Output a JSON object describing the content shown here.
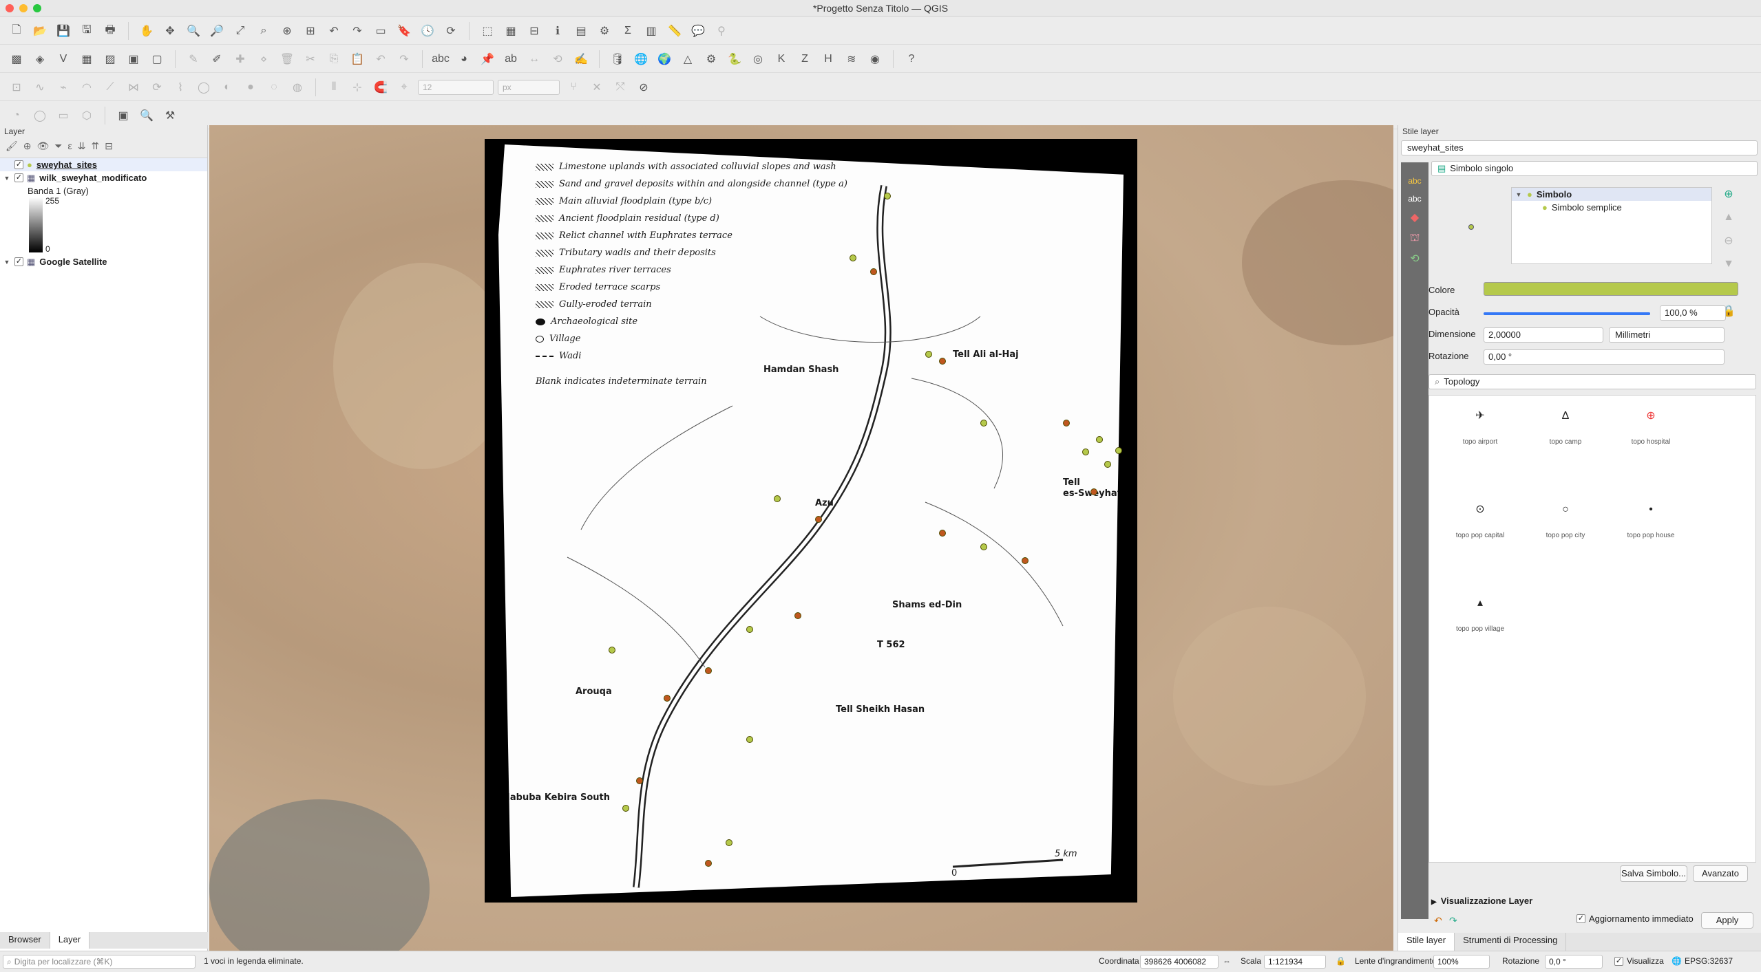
{
  "window": {
    "title": "*Progetto Senza Titolo — QGIS"
  },
  "toolbars": {
    "scale_value": "12",
    "unit_value": "px"
  },
  "layers_panel": {
    "title": "Layer",
    "layers": [
      {
        "name": "sweyhat_sites",
        "checked": "✓"
      },
      {
        "name": "wilk_sweyhat_modificato",
        "checked": "✓"
      },
      {
        "name": "Google Satellite",
        "checked": "✓"
      }
    ],
    "band_label": "Banda 1 (Gray)",
    "band_max": "255",
    "band_min": "0",
    "tabs": [
      "Browser",
      "Layer"
    ]
  },
  "map": {
    "legend": [
      "Limestone uplands with associated colluvial slopes and wash",
      "Sand and gravel deposits within and alongside channel (type a)",
      "Main alluvial floodplain (type b/c)",
      "Ancient floodplain residual (type d)",
      "Relict channel with Euphrates terrace",
      "Tributary wadis and their deposits",
      "Euphrates river terraces",
      "Eroded terrace scarps",
      "Gully-eroded terrain",
      "Archaeological site",
      "Village",
      "Wadi"
    ],
    "legend_note": "Blank indicates indeterminate terrain",
    "places": {
      "tell_ali": "Tell Ali al-Haj",
      "hamdan": "Hamdan Shash",
      "tell_sweyhat_1": "Tell",
      "tell_sweyhat_2": "es-Sweyhat",
      "azu": "Azu",
      "shams": "Shams ed-Din",
      "t562": "T 562",
      "arouqa": "Arouqa",
      "sheikh": "Tell Sheikh Hasan",
      "habuba": "Habuba Kebira South",
      "scale_0": "0",
      "scale_5": "5 km"
    }
  },
  "style_panel": {
    "title": "Stile layer",
    "layer_select": "sweyhat_sites",
    "renderer": "Simbolo singolo",
    "tree_root": "Simbolo",
    "tree_child": "Simbolo semplice",
    "color_label": "Colore",
    "color_value": "#b5c94b",
    "opacity_label": "Opacità",
    "opacity_value": "100,0 %",
    "opacity_level": 1.0,
    "size_label": "Dimensione",
    "size_value": "2,00000",
    "size_unit": "Millimetri",
    "rotation_label": "Rotazione",
    "rotation_value": "0,00 °",
    "search_value": "Topology",
    "symbols": [
      {
        "name": "topo airport",
        "icon": "airplane-icon",
        "glyph": "✈"
      },
      {
        "name": "topo camp",
        "icon": "camp-icon",
        "glyph": "Δ"
      },
      {
        "name": "topo hospital",
        "icon": "hospital-icon",
        "glyph": "⊕"
      },
      {
        "name": "topo pop capital",
        "icon": "capital-icon",
        "glyph": "⊙"
      },
      {
        "name": "topo pop city",
        "icon": "city-icon",
        "glyph": "○"
      },
      {
        "name": "topo pop house",
        "icon": "house-icon",
        "glyph": "•"
      },
      {
        "name": "topo pop village",
        "icon": "village-icon",
        "glyph": "▴"
      }
    ],
    "save_symbol": "Salva Simbolo...",
    "advanced": "Avanzato",
    "render_section": "Visualizzazione Layer",
    "live_update": "Aggiornamento immediato",
    "apply": "Apply",
    "tabs": [
      "Stile layer",
      "Strumenti di Processing"
    ]
  },
  "statusbar": {
    "search_placeholder": "Digita per localizzare (⌘K)",
    "message": "1 voci in legenda eliminate.",
    "coord_label": "Coordinata",
    "coord_value": "398626 4006082",
    "scale_label": "Scala",
    "scale_value": "1:121934",
    "magnifier_label": "Lente d'ingrandimento",
    "magnifier_value": "100%",
    "rotation_label": "Rotazione",
    "rotation_value": "0,0 °",
    "render_label": "Visualizza",
    "crs": "EPSG:32637"
  }
}
